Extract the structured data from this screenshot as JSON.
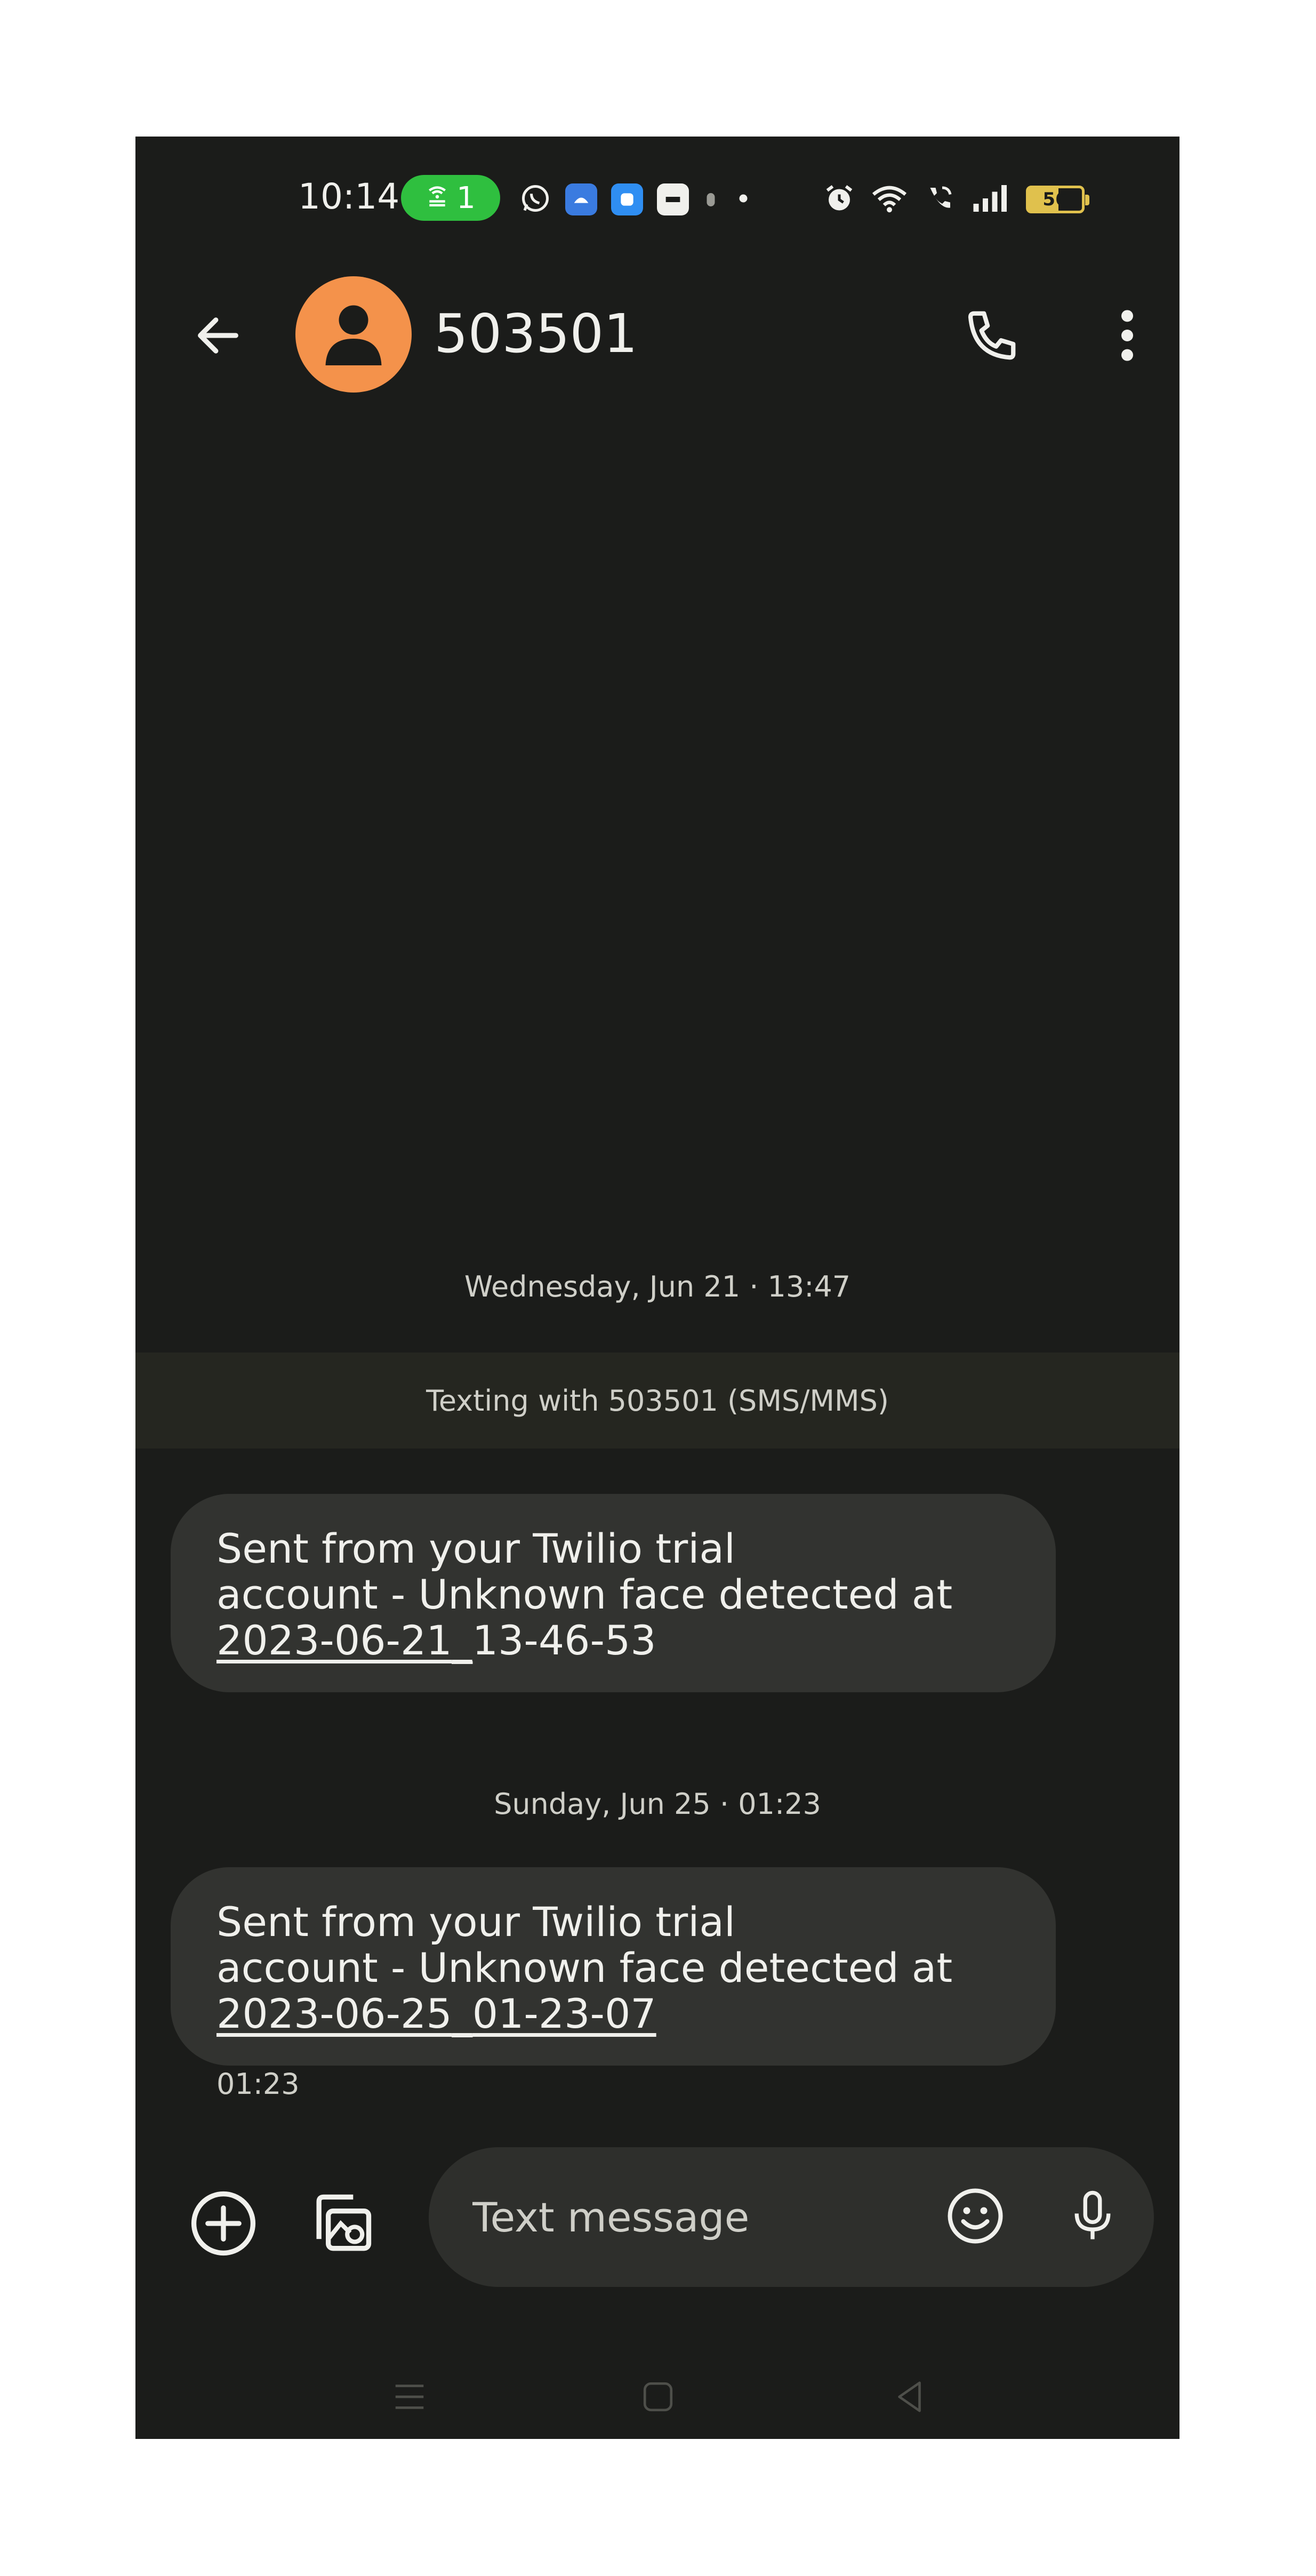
{
  "status_bar": {
    "time": "10:14",
    "hotspot_count": "1",
    "battery_level": "56"
  },
  "header": {
    "contact_name": "503501"
  },
  "conversation": {
    "date_1": "Wednesday, Jun 21 · 13:47",
    "texting_banner": "Texting with 503501 (SMS/MMS)",
    "messages": [
      {
        "line1": "Sent from your Twilio trial",
        "line2": "account - Unknown face detected at",
        "link_a": "2023-06-21",
        "link_sep": "_",
        "link_b": "13-46-53"
      },
      {
        "line1": "Sent from your Twilio trial",
        "line2": "account - Unknown face detected at",
        "link_a": "2023-06-25",
        "link_sep": "_",
        "link_b": "01-23-07"
      }
    ],
    "date_2": "Sunday, Jun 25 · 01:23",
    "last_message_time": "01:23"
  },
  "compose": {
    "placeholder": "Text message"
  },
  "colors": {
    "background": "#1b1c1a",
    "avatar": "#f4924b",
    "bubble": "#323330",
    "hotspot_pill": "#2fbf3f",
    "battery": "#e0c14d"
  },
  "icons": {
    "status": [
      "hotspot-icon",
      "whatsapp-icon",
      "app-icon",
      "app-icon",
      "app-icon",
      "dot-icon",
      "alarm-icon",
      "wifi-icon",
      "wifi-calling-icon",
      "signal-icon",
      "battery-icon"
    ],
    "header": [
      "back-arrow-icon",
      "person-icon",
      "phone-icon",
      "more-vert-icon"
    ],
    "compose": [
      "add-circle-icon",
      "gallery-icon",
      "emoji-icon",
      "mic-icon"
    ],
    "nav": [
      "menu-icon",
      "home-icon",
      "back-icon"
    ]
  }
}
